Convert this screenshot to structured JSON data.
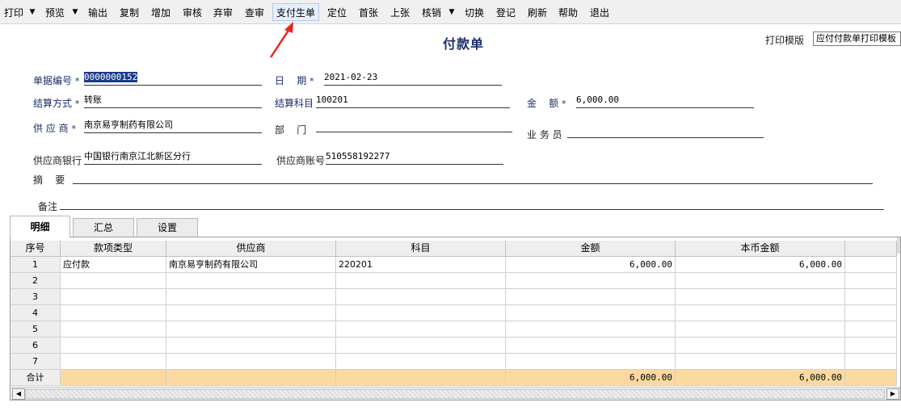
{
  "toolbar": {
    "items": [
      "打印",
      "预览",
      "输出",
      "复制",
      "增加",
      "审核",
      "弃审",
      "查审",
      "支付生单",
      "定位",
      "首张",
      "上张",
      "核销",
      "切换",
      "登记",
      "刷新",
      "帮助",
      "退出"
    ],
    "dropdown_arrow": "▼"
  },
  "header": {
    "title": "付款单",
    "template_label": "打印模版",
    "template_value": "应付付款单打印模板",
    "required_mark": "*"
  },
  "form": {
    "doc_no_label": "单据编号",
    "doc_no": "0000000152",
    "date_label": "日    期",
    "date": "2021-02-23",
    "settle_method_label": "结算方式",
    "settle_method": "转账",
    "settle_subject_label": "结算科目",
    "settle_subject": "100201",
    "amount_label": "金    额",
    "amount": "6,000.00",
    "supplier_label": "供 应 商",
    "supplier": "南京易亨制药有限公司",
    "dept_label": "部    门",
    "dept": "",
    "salesman_label": "业 务 员",
    "salesman": "",
    "supplier_bank_label": "供应商银行",
    "supplier_bank": "中国银行南京江北新区分行",
    "supplier_account_label": "供应商账号",
    "supplier_account": "510558192277",
    "summary_label": "摘    要",
    "summary": "",
    "remark_label": "备注",
    "remark": ""
  },
  "tabs": [
    "明细",
    "汇总",
    "设置"
  ],
  "grid": {
    "columns": [
      "序号",
      "款项类型",
      "供应商",
      "科目",
      "金额",
      "本币金额"
    ],
    "rows": [
      {
        "idx": "1",
        "type": "应付款",
        "supplier": "南京易亨制药有限公司",
        "subject": "220201",
        "amount": "6,000.00",
        "local_amount": "6,000.00"
      },
      {
        "idx": "2",
        "type": "",
        "supplier": "",
        "subject": "",
        "amount": "",
        "local_amount": ""
      },
      {
        "idx": "3",
        "type": "",
        "supplier": "",
        "subject": "",
        "amount": "",
        "local_amount": ""
      },
      {
        "idx": "4",
        "type": "",
        "supplier": "",
        "subject": "",
        "amount": "",
        "local_amount": ""
      },
      {
        "idx": "5",
        "type": "",
        "supplier": "",
        "subject": "",
        "amount": "",
        "local_amount": ""
      },
      {
        "idx": "6",
        "type": "",
        "supplier": "",
        "subject": "",
        "amount": "",
        "local_amount": ""
      },
      {
        "idx": "7",
        "type": "",
        "supplier": "",
        "subject": "",
        "amount": "",
        "local_amount": ""
      }
    ],
    "total": {
      "label": "合计",
      "amount": "6,000.00",
      "local_amount": "6,000.00"
    }
  },
  "colors": {
    "label": "#1b2f6b",
    "total_row": "#fcd9a0",
    "selection": "#1a3a8a",
    "annotation_arrow": "#e8251f"
  },
  "icons": {
    "scroll_left": "◀",
    "scroll_right": "▶"
  }
}
